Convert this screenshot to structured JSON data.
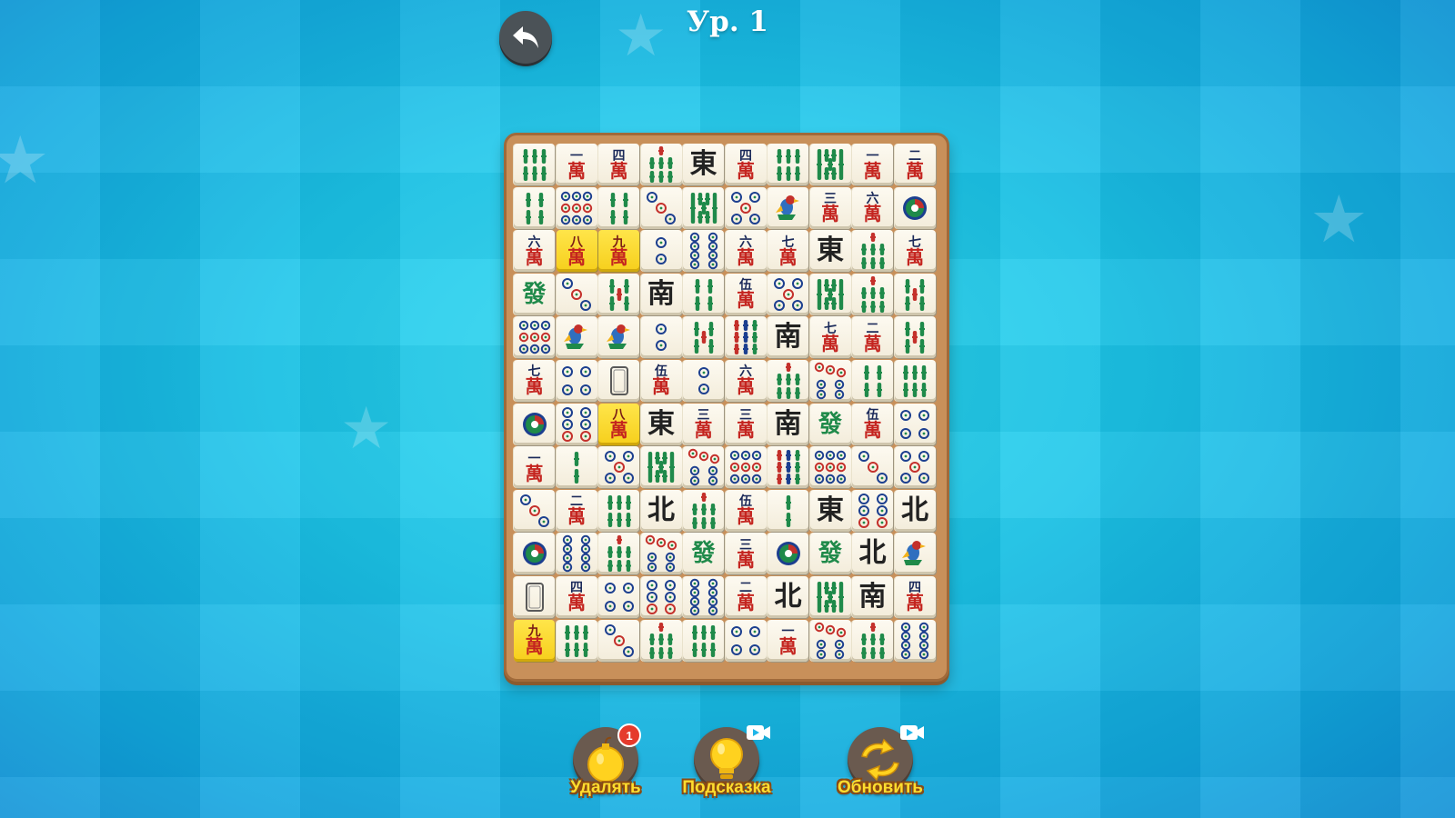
{
  "header": {
    "level_label": "Ур. 1"
  },
  "colors": {
    "board_wood": "#c8905a",
    "highlight_tile": "#f6cf1c",
    "label_yellow": "#ffdd2e",
    "man_red": "#c4241f"
  },
  "board": {
    "columns": 10,
    "rows": 12,
    "highlighted_tiles": [
      [
        2,
        1
      ],
      [
        2,
        2
      ],
      [
        6,
        2
      ],
      [
        11,
        0
      ]
    ],
    "tiles": [
      [
        "b6",
        "m1",
        "m4",
        "b7",
        "east",
        "m4",
        "b6",
        "b8",
        "m1",
        "m2"
      ],
      [
        "b4",
        "p9",
        "b4",
        "p3",
        "b8",
        "p5",
        "b1",
        "m3",
        "m6",
        "p1"
      ],
      [
        "m6",
        "m8",
        "m9",
        "p2",
        "p8",
        "m6",
        "m7",
        "east",
        "b7",
        "m7"
      ],
      [
        "green",
        "p3",
        "b5",
        "south",
        "b4",
        "m5",
        "p5",
        "b8",
        "b7",
        "b5"
      ],
      [
        "p9",
        "b1",
        "b1",
        "p2",
        "b5",
        "b9",
        "south",
        "m7",
        "m2",
        "b5"
      ],
      [
        "m7",
        "p4",
        "white",
        "m5",
        "p2",
        "m6",
        "b7",
        "p7",
        "b4",
        "b6"
      ],
      [
        "p1",
        "p6",
        "m8",
        "east",
        "m3",
        "m3",
        "south",
        "green",
        "m5",
        "p4"
      ],
      [
        "m1",
        "b2",
        "p5",
        "b8",
        "p7",
        "p9",
        "b9",
        "p9",
        "p3",
        "p5"
      ],
      [
        "p3",
        "m2",
        "b6",
        "north",
        "b7",
        "m5",
        "b2",
        "east",
        "p6",
        "north"
      ],
      [
        "p1",
        "p8",
        "b7",
        "p7",
        "green",
        "m3",
        "p1",
        "green",
        "north",
        "b1"
      ],
      [
        "white",
        "m4",
        "p4",
        "p6",
        "p8",
        "m2",
        "north",
        "b8",
        "south",
        "m4"
      ],
      [
        "m9",
        "b6",
        "p3",
        "b7",
        "b6",
        "p4",
        "m1",
        "p7",
        "b7",
        "p8"
      ]
    ]
  },
  "glyphs": {
    "east": "東",
    "south": "南",
    "north": "北",
    "green": "發",
    "wan": "萬",
    "numerals": [
      "一",
      "二",
      "三",
      "四",
      "伍",
      "六",
      "七",
      "八",
      "九"
    ]
  },
  "tools": [
    {
      "id": "remove",
      "label": "Удалять",
      "badge": "1",
      "icon": "bomb-icon"
    },
    {
      "id": "hint",
      "label": "Подсказка",
      "icon": "lightbulb-icon"
    },
    {
      "id": "shuffle",
      "label": "Обновить",
      "icon": "shuffle-icon"
    }
  ]
}
